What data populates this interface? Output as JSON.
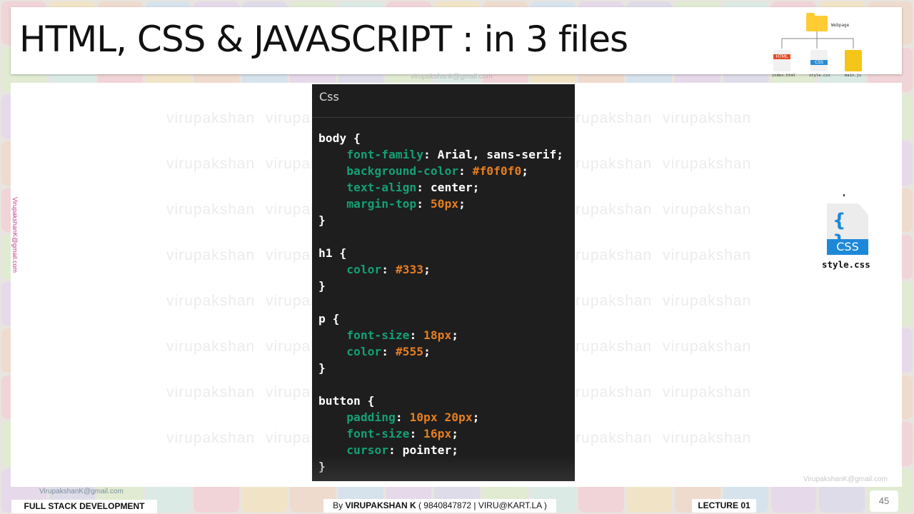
{
  "slide": {
    "title": "HTML, CSS &  JAVASCRIPT : in 3 files",
    "email_top": "virupakshank@gmail.com",
    "email_right": "VirupakshanK@gmail.com",
    "email_bottom": "VirupakshanK@gmail.com",
    "side_email_left": "VirupakshanK@gmail.com",
    "watermark_text": "virupakshan"
  },
  "mini_diagram": {
    "folder_label": "Webpage",
    "files": [
      {
        "name": "index.html",
        "badge": "HTML"
      },
      {
        "name": "style.css",
        "badge": "CSS"
      },
      {
        "name": "main.js",
        "badge": "JS"
      }
    ]
  },
  "code_panel": {
    "tab_label": "Css",
    "lines": [
      [
        {
          "t": "body {",
          "c": "val"
        }
      ],
      [
        {
          "t": "    font-family",
          "c": "prop"
        },
        {
          "t": ": Arial, sans-serif;",
          "c": "val"
        }
      ],
      [
        {
          "t": "    background-color",
          "c": "prop"
        },
        {
          "t": ": ",
          "c": "val"
        },
        {
          "t": "#f0f0f0",
          "c": "num"
        },
        {
          "t": ";",
          "c": "val"
        }
      ],
      [
        {
          "t": "    text-align",
          "c": "prop"
        },
        {
          "t": ": center;",
          "c": "val"
        }
      ],
      [
        {
          "t": "    margin-top",
          "c": "prop"
        },
        {
          "t": ": ",
          "c": "val"
        },
        {
          "t": "50px",
          "c": "num"
        },
        {
          "t": ";",
          "c": "val"
        }
      ],
      [
        {
          "t": "}",
          "c": "val"
        }
      ],
      [
        {
          "t": "",
          "c": "val"
        }
      ],
      [
        {
          "t": "h1 {",
          "c": "val"
        }
      ],
      [
        {
          "t": "    color",
          "c": "prop"
        },
        {
          "t": ": ",
          "c": "val"
        },
        {
          "t": "#333",
          "c": "num"
        },
        {
          "t": ";",
          "c": "val"
        }
      ],
      [
        {
          "t": "}",
          "c": "val"
        }
      ],
      [
        {
          "t": "",
          "c": "val"
        }
      ],
      [
        {
          "t": "p {",
          "c": "val"
        }
      ],
      [
        {
          "t": "    font-size",
          "c": "prop"
        },
        {
          "t": ": ",
          "c": "val"
        },
        {
          "t": "18px",
          "c": "num"
        },
        {
          "t": ";",
          "c": "val"
        }
      ],
      [
        {
          "t": "    color",
          "c": "prop"
        },
        {
          "t": ": ",
          "c": "val"
        },
        {
          "t": "#555",
          "c": "num"
        },
        {
          "t": ";",
          "c": "val"
        }
      ],
      [
        {
          "t": "}",
          "c": "val"
        }
      ],
      [
        {
          "t": "",
          "c": "val"
        }
      ],
      [
        {
          "t": "button {",
          "c": "val"
        }
      ],
      [
        {
          "t": "    padding",
          "c": "prop"
        },
        {
          "t": ": ",
          "c": "val"
        },
        {
          "t": "10px 20px",
          "c": "num"
        },
        {
          "t": ";",
          "c": "val"
        }
      ],
      [
        {
          "t": "    font-size",
          "c": "prop"
        },
        {
          "t": ": ",
          "c": "val"
        },
        {
          "t": "16px",
          "c": "num"
        },
        {
          "t": ";",
          "c": "val"
        }
      ],
      [
        {
          "t": "    cursor",
          "c": "prop"
        },
        {
          "t": ": pointer;",
          "c": "val"
        }
      ],
      [
        {
          "t": "}",
          "c": "val"
        }
      ]
    ]
  },
  "css_icon": {
    "braces": "{ }",
    "badge": "CSS",
    "filename": "style.css"
  },
  "footer": {
    "course": "FULL STACK DEVELOPMENT",
    "author_prefix": "By ",
    "author_name": "VIRUPAKSHAN K",
    "author_contact": " ( 9840847872 | VIRU@KART.LA )",
    "lecture": "LECTURE 01",
    "page_number": "45"
  },
  "colors": {
    "code_bg": "#1e1e1e",
    "property": "#14a076",
    "number": "#e67e22",
    "css_blue": "#1e88d8"
  }
}
